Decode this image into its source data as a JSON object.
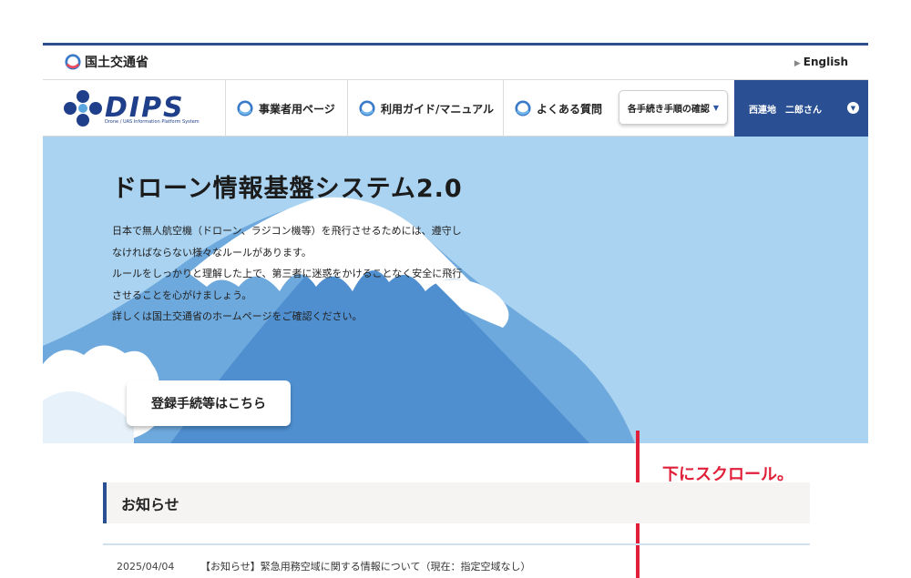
{
  "header": {
    "ministry_name": "国土交通省",
    "english_link": "English"
  },
  "nav": {
    "brand_name": "DIPS",
    "brand_subtitle": "Drone / UAS Information Platform System",
    "items": [
      {
        "label": "事業者用ページ"
      },
      {
        "label": "利用ガイド/マニュアル"
      },
      {
        "label": "よくある質問"
      }
    ],
    "procedure_select": "各手続き手順の確認",
    "user_name": "西連地　二郎さん"
  },
  "hero": {
    "title": "ドローン情報基盤システム2.0",
    "lines": [
      "日本で無人航空機（ドローン、ラジコン機等）を飛行させるためには、遵守し",
      "なければならない様々なルールがあります。",
      "ルールをしっかりと理解した上で、第三者に迷惑をかけることなく安全に飛行",
      "させることを心がけましょう。",
      "詳しくは国土交通省のホームページをご確認ください。"
    ],
    "button": "登録手続等はこちら"
  },
  "annotation": {
    "text": "下にスクロール。",
    "color": "#e0203a"
  },
  "news": {
    "heading": "お知らせ",
    "items": [
      {
        "date": "2025/04/04",
        "text": "【お知らせ】緊急用務空域に関する情報について（現在：指定空域なし）"
      }
    ]
  },
  "colors": {
    "brand": "#2a4f92",
    "sky": "#a9d3f1"
  }
}
